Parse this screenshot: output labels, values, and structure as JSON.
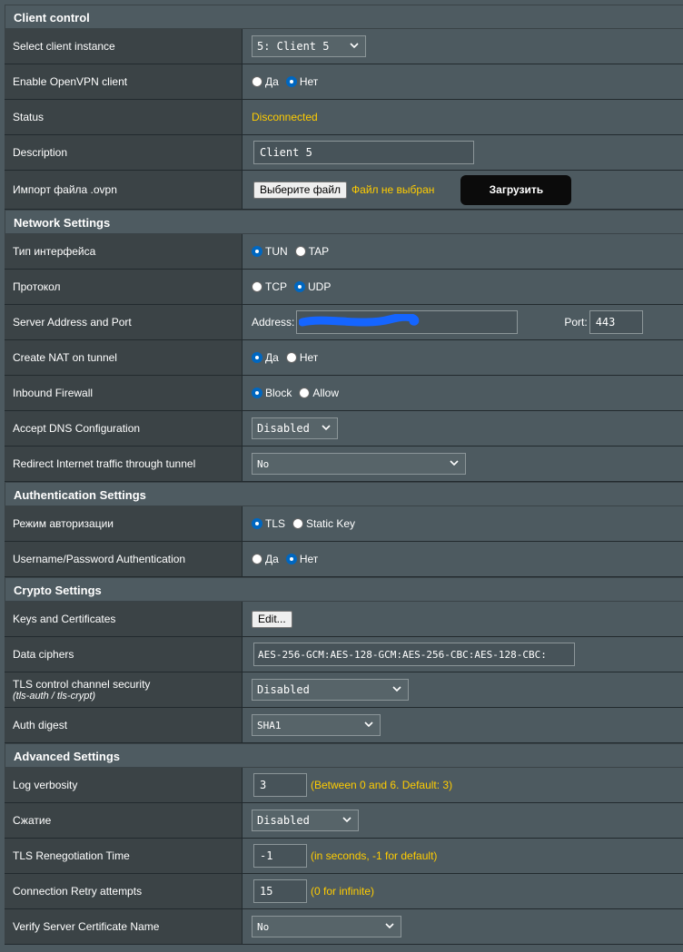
{
  "client_control": {
    "title": "Client control",
    "instance_label": "Select client instance",
    "instance_value": "5: Client 5",
    "enable_label": "Enable OpenVPN client",
    "yes": "Да",
    "no": "Нет",
    "status_label": "Status",
    "status_value": "Disconnected",
    "description_label": "Description",
    "description_value": "Client 5",
    "import_label": "Импорт файла .ovpn",
    "choose_file": "Выберите файл",
    "no_file": "Файл не выбран",
    "upload": "Загрузить"
  },
  "network": {
    "title": "Network Settings",
    "iface_label": "Тип интерфейса",
    "iface_opt1": "TUN",
    "iface_opt2": "TAP",
    "proto_label": "Протокол",
    "proto_opt1": "TCP",
    "proto_opt2": "UDP",
    "server_label": "Server Address and Port",
    "address_label": "Address:",
    "port_label": "Port:",
    "port_value": "443",
    "nat_label": "Create NAT on tunnel",
    "yes": "Да",
    "no": "Нет",
    "firewall_label": "Inbound Firewall",
    "fw_opt1": "Block",
    "fw_opt2": "Allow",
    "dns_label": "Accept DNS Configuration",
    "dns_value": "Disabled",
    "redirect_label": "Redirect Internet traffic through tunnel",
    "redirect_value": "No"
  },
  "auth": {
    "title": "Authentication Settings",
    "mode_label": "Режим авторизации",
    "mode_opt1": "TLS",
    "mode_opt2": "Static Key",
    "userpass_label": "Username/Password Authentication",
    "yes": "Да",
    "no": "Нет"
  },
  "crypto": {
    "title": "Crypto Settings",
    "keys_label": "Keys and Certificates",
    "edit": "Edit...",
    "ciphers_label": "Data ciphers",
    "ciphers_value": "AES-256-GCM:AES-128-GCM:AES-256-CBC:AES-128-CBC:",
    "tls_label": "TLS control channel security",
    "tls_sub": "(tls-auth / tls-crypt)",
    "tls_value": "Disabled",
    "digest_label": "Auth digest",
    "digest_value": "SHA1"
  },
  "advanced": {
    "title": "Advanced Settings",
    "verb_label": "Log verbosity",
    "verb_value": "3",
    "verb_hint": "(Between 0 and 6. Default: 3)",
    "comp_label": "Сжатие",
    "comp_value": "Disabled",
    "reneg_label": "TLS Renegotiation Time",
    "reneg_value": "-1",
    "reneg_hint": "(in seconds, -1 for default)",
    "retry_label": "Connection Retry attempts",
    "retry_value": "15",
    "retry_hint": "(0 for infinite)",
    "verify_label": "Verify Server Certificate Name",
    "verify_value": "No"
  },
  "colors": {
    "accent": "#ffcc00",
    "radio_on": "#0067c0",
    "redaction": "#1565ff"
  }
}
